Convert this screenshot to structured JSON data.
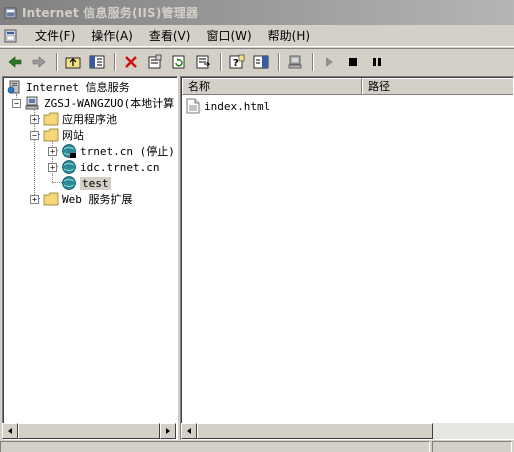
{
  "window": {
    "title": "Internet 信息服务(IIS)管理器"
  },
  "menu": {
    "items": [
      {
        "label": "文件(F)"
      },
      {
        "label": "操作(A)"
      },
      {
        "label": "查看(V)"
      },
      {
        "label": "窗口(W)"
      },
      {
        "label": "帮助(H)"
      }
    ]
  },
  "toolbar": {
    "buttons": [
      "back-icon",
      "forward-icon",
      "up-folder-icon",
      "show-tree-icon",
      "delete-icon",
      "properties-icon",
      "refresh-icon",
      "export-icon",
      "help-icon",
      "show-pane-icon",
      "computer-icon",
      "play-icon",
      "stop-icon",
      "pause-icon"
    ]
  },
  "tree": {
    "root": "Internet 信息服务",
    "server": "ZGSJ-WANGZUO(本地计算",
    "app_pools": "应用程序池",
    "websites": "网站",
    "sites": [
      {
        "label": "trnet.cn (停止)"
      },
      {
        "label": "idc.trnet.cn"
      },
      {
        "label": "test"
      }
    ],
    "web_ext": "Web 服务扩展",
    "expander_plus": "+",
    "expander_minus": "−"
  },
  "list": {
    "columns": [
      {
        "label": "名称"
      },
      {
        "label": "路径"
      }
    ],
    "rows": [
      {
        "name": "index.html"
      }
    ]
  },
  "colors": {
    "title_start": "#808080",
    "title_end": "#b5b5b5",
    "face": "#d4d0c8"
  }
}
